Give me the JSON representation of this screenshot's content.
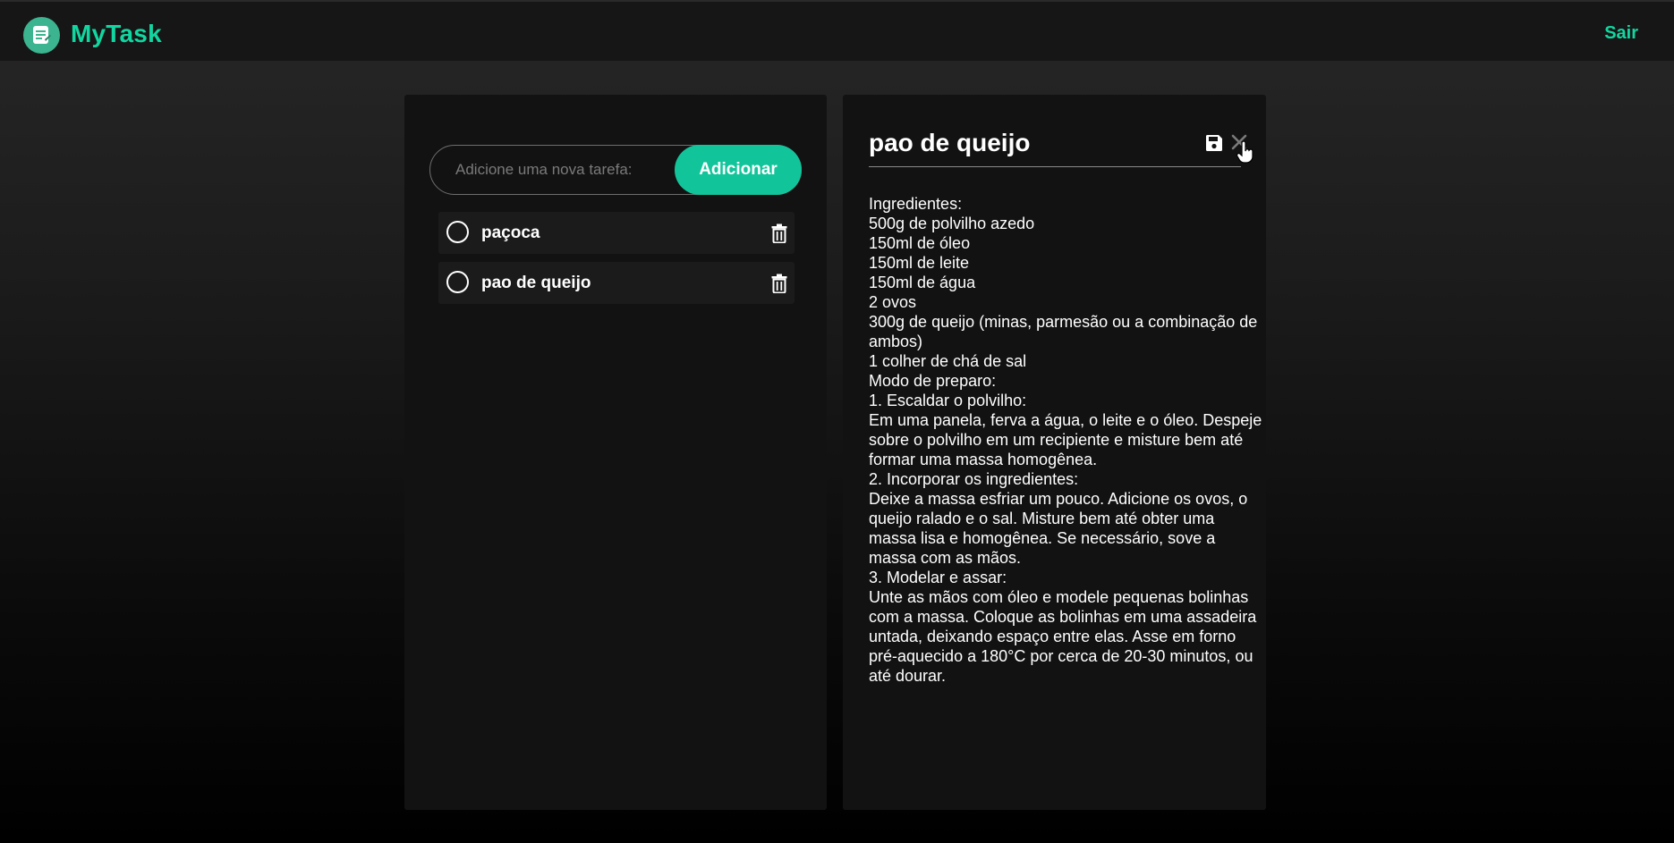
{
  "header": {
    "brand": "MyTask",
    "logout_label": "Sair",
    "logo_icon": "notepad-icon",
    "accent_color": "#12d6a0"
  },
  "add_task": {
    "placeholder": "Adicione uma nova tarefa:",
    "value": "",
    "button_label": "Adicionar"
  },
  "tasks": [
    {
      "title": "paçoca",
      "done": false
    },
    {
      "title": "pao de queijo",
      "done": false
    }
  ],
  "detail": {
    "title": "pao de queijo",
    "lines": [
      "Ingredientes:",
      "500g de polvilho azedo",
      "150ml de óleo",
      "150ml de leite",
      "150ml de água",
      "2 ovos",
      "300g de queijo (minas, parmesão ou a combinação de ambos)",
      "1 colher de chá de sal",
      "Modo de preparo:",
      "1. Escaldar o polvilho:",
      "Em uma panela, ferva a água, o leite e o óleo. Despeje sobre o polvilho em um recipiente e misture bem até formar uma massa homogênea.",
      "2. Incorporar os ingredientes:",
      "Deixe a massa esfriar um pouco. Adicione os ovos, o queijo ralado e o sal. Misture bem até obter uma massa lisa e homogênea. Se necessário, sove a massa com as mãos.",
      "3. Modelar e assar:",
      "Unte as mãos com óleo e modele pequenas bolinhas com a massa. Coloque as bolinhas em uma assadeira untada, deixando espaço entre elas. Asse em forno pré-aquecido a 180°C por cerca de 20-30 minutos, ou até dourar."
    ]
  }
}
